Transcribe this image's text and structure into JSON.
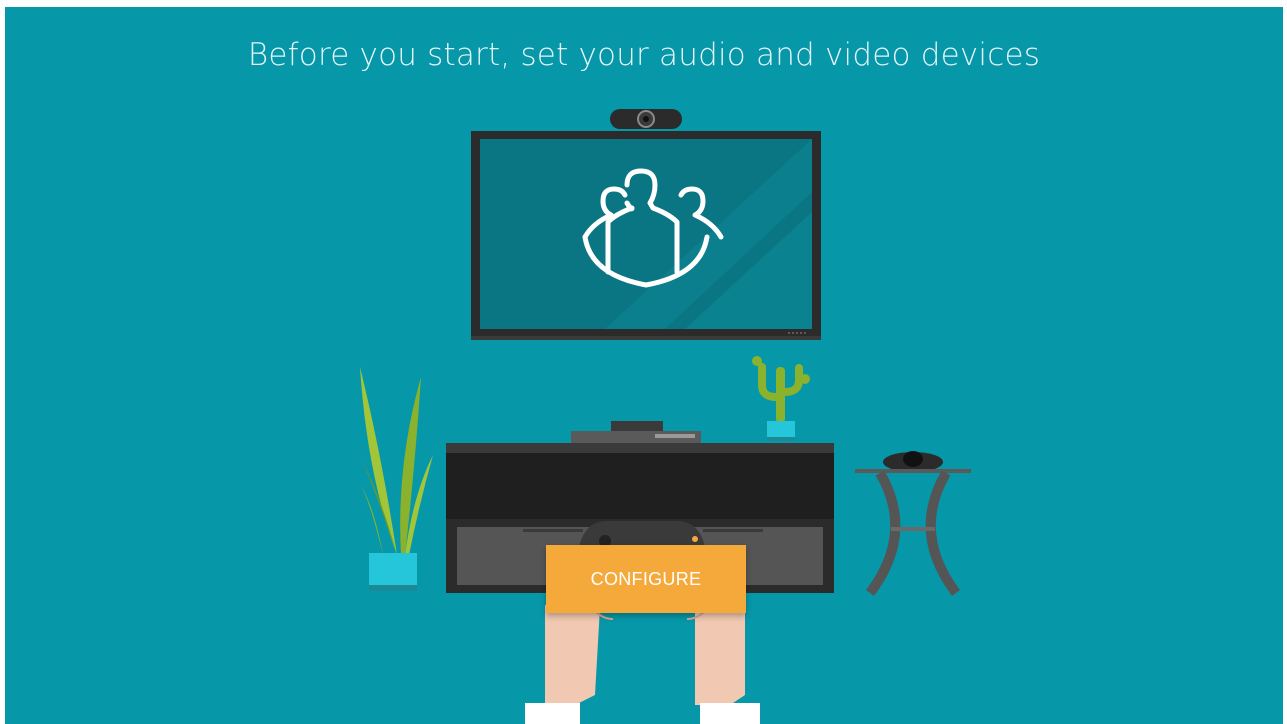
{
  "page": {
    "headline": "Before you start, set your audio and video devices"
  },
  "actions": {
    "configure_label": "CONFIGURE"
  },
  "icons": {
    "camera": "webcam-icon",
    "screen": "group-people-icon"
  },
  "colors": {
    "background": "#0697a9",
    "button": "#f6a93b",
    "screen": "#0a7683",
    "frame": "#2b2b2b"
  }
}
